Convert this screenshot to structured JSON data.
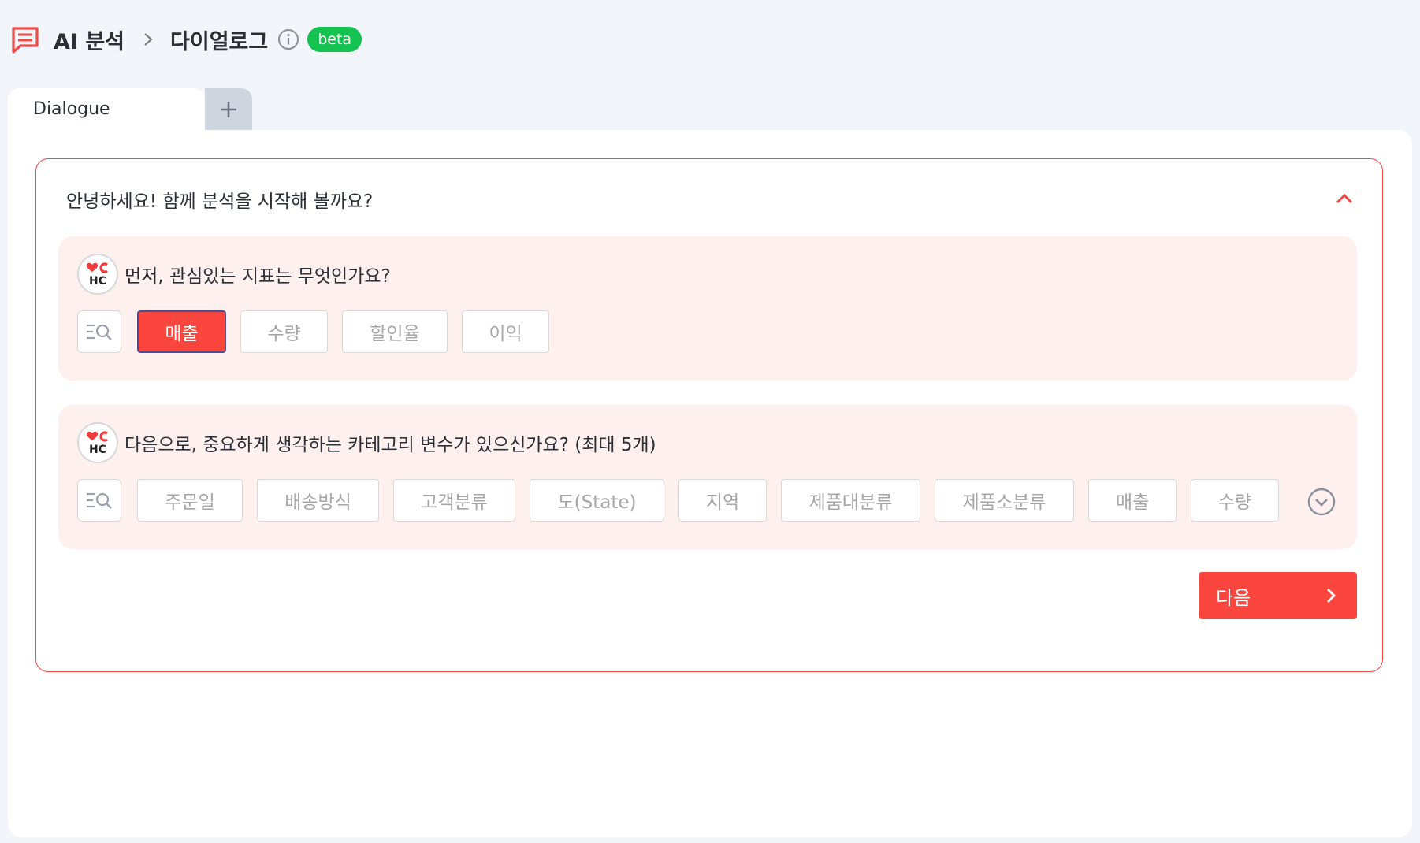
{
  "breadcrumb": {
    "root": "AI 분석",
    "current": "다이얼로그",
    "badge": "beta"
  },
  "tabs": {
    "active_label": "Dialogue",
    "add_icon": "plus-icon"
  },
  "dialog": {
    "title": "안녕하세요! 함께 분석을 시작해 볼까요?",
    "questions": [
      {
        "text": "먼저, 관심있는 지표는 무엇인가요?",
        "options": [
          "매출",
          "수량",
          "할인율",
          "이익"
        ],
        "selected": "매출"
      },
      {
        "text": "다음으로, 중요하게 생각하는 카테고리 변수가 있으신가요? (최대 5개)",
        "options": [
          "주문일",
          "배송방식",
          "고객분류",
          "도(State)",
          "지역",
          "제품대분류",
          "제품소분류",
          "매출",
          "수량"
        ]
      }
    ],
    "next_label": "다음"
  },
  "colors": {
    "accent": "#fb453f",
    "badge": "#13c24f",
    "panel": "#fff0f0"
  }
}
